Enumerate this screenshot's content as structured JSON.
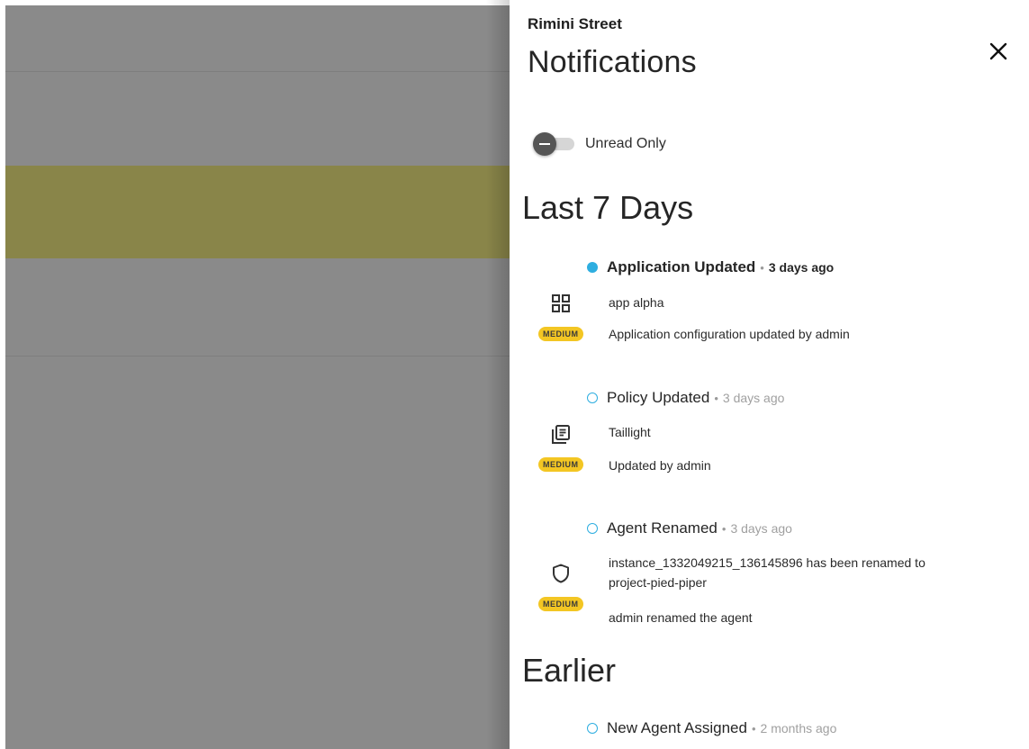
{
  "drawer": {
    "org_name": "Rimini Street",
    "title": "Notifications",
    "unread_toggle": {
      "label": "Unread Only",
      "on": false
    }
  },
  "sections": [
    {
      "label": "Last 7 Days"
    },
    {
      "label": "Earlier"
    }
  ],
  "notifications": [
    {
      "title": "Application Updated",
      "age": "3 days ago",
      "unread": true,
      "icon": "grid-icon",
      "severity": "MEDIUM",
      "subject": "app alpha",
      "detail": "Application configuration updated by admin"
    },
    {
      "title": "Policy Updated",
      "age": "3 days ago",
      "unread": false,
      "icon": "policy-document-icon",
      "severity": "MEDIUM",
      "subject": "Taillight",
      "detail": "Updated by admin"
    },
    {
      "title": "Agent Renamed",
      "age": "3 days ago",
      "unread": false,
      "icon": "shield-icon",
      "severity": "MEDIUM",
      "subject": "instance_1332049215_136145896 has been renamed to",
      "subject_cont": "project-pied-piper",
      "detail": "admin renamed the agent"
    },
    {
      "title": "New Agent Assigned",
      "age": "2 months ago",
      "unread": false
    }
  ],
  "separator": "•",
  "colors": {
    "accent": "#2eaee0",
    "badge": "#f3c623",
    "backdrop": "#8a8a8a",
    "backdrop_highlight": "#898549"
  }
}
